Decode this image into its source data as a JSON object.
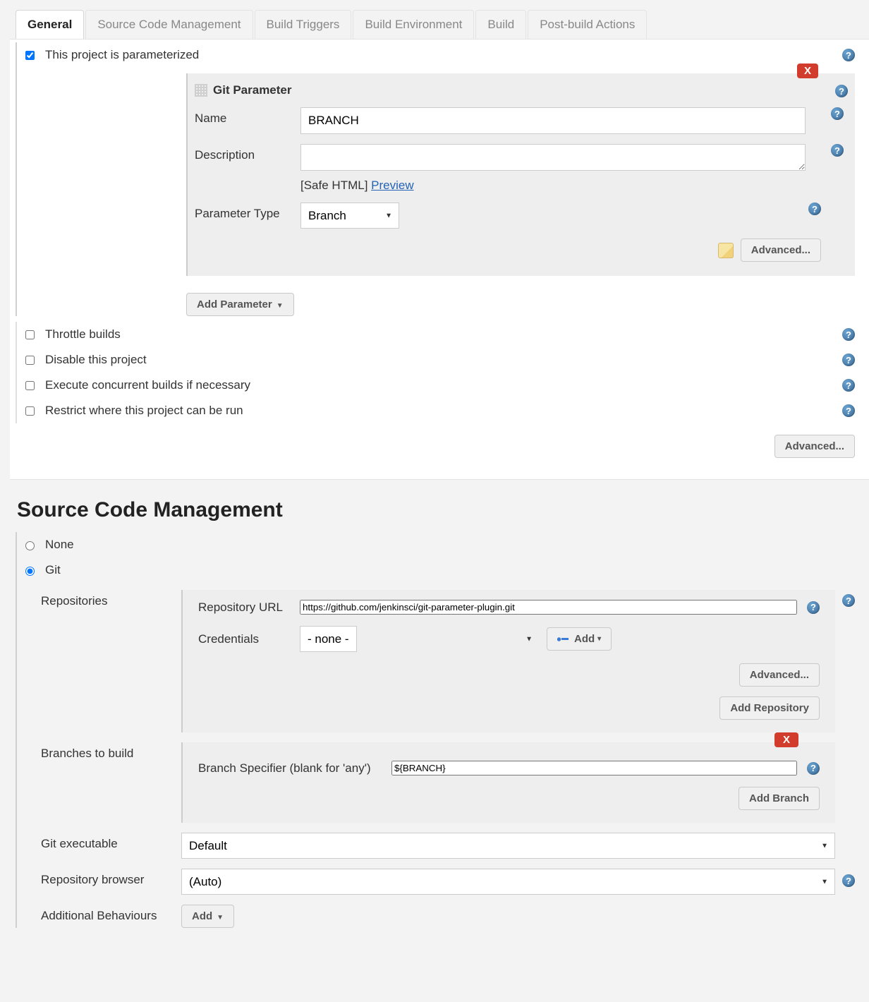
{
  "tabs": [
    "General",
    "Source Code Management",
    "Build Triggers",
    "Build Environment",
    "Build",
    "Post-build Actions"
  ],
  "general": {
    "parameterized": "This project is parameterized",
    "throttle": "Throttle builds",
    "disable": "Disable this project",
    "concurrent": "Execute concurrent builds if necessary",
    "restrict": "Restrict where this project can be run",
    "add_parameter": "Add Parameter",
    "advanced": "Advanced..."
  },
  "git_param": {
    "title": "Git Parameter",
    "name_lbl": "Name",
    "name_val": "BRANCH",
    "desc_lbl": "Description",
    "desc_val": "",
    "safe_html": "[Safe HTML]",
    "preview": "Preview",
    "type_lbl": "Parameter Type",
    "type_val": "Branch",
    "advanced": "Advanced...",
    "x": "X"
  },
  "scm": {
    "heading": "Source Code Management",
    "none": "None",
    "git": "Git",
    "repositories": "Repositories",
    "repo_url_lbl": "Repository URL",
    "repo_url_val": "https://github.com/jenkinsci/git-parameter-plugin.git",
    "credentials_lbl": "Credentials",
    "credentials_val": "- none -",
    "add": "Add",
    "advanced": "Advanced...",
    "add_repository": "Add Repository",
    "branches_to_build": "Branches to build",
    "branch_spec_lbl": "Branch Specifier (blank for 'any')",
    "branch_spec_val": "${BRANCH}",
    "add_branch": "Add Branch",
    "x": "X",
    "git_exec_lbl": "Git executable",
    "git_exec_val": "Default",
    "repo_browser_lbl": "Repository browser",
    "repo_browser_val": "(Auto)",
    "add_behaviours_lbl": "Additional Behaviours",
    "add_btn": "Add"
  }
}
